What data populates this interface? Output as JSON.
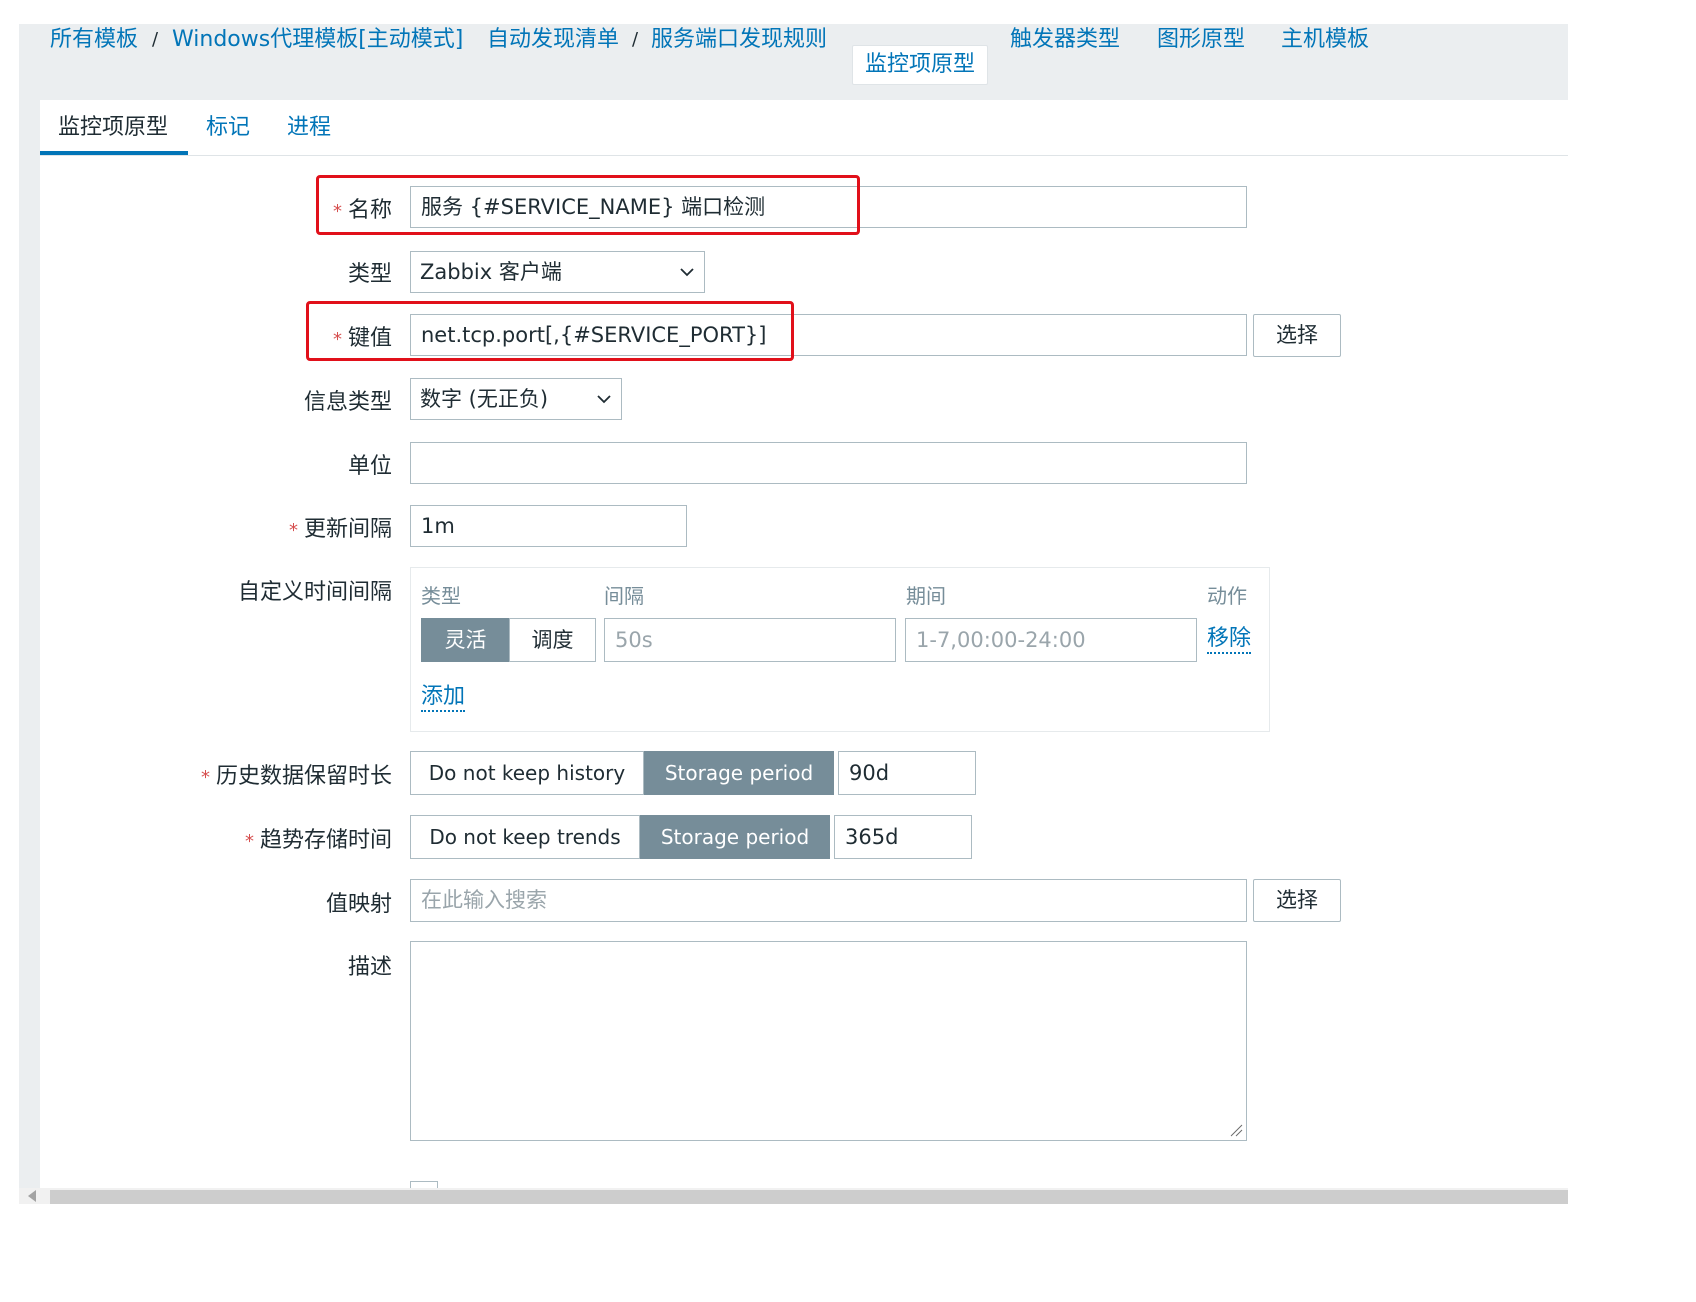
{
  "breadcrumb": {
    "all_templates": "所有模板",
    "template": "Windows代理模板[主动模式]",
    "discovery_list": "自动发现清单",
    "discovery_rule": "服务端口发现规则",
    "sep": "/"
  },
  "nav": {
    "item_prototypes": "监控项原型",
    "trigger_types": "触发器类型",
    "graph_prototypes": "图形原型",
    "host_templates": "主机模板"
  },
  "tabs": [
    "监控项原型",
    "标记",
    "进程"
  ],
  "form": {
    "required_mark": "*",
    "name_label": "名称",
    "name_value": "服务 {#SERVICE_NAME} 端口检测",
    "type_label": "类型",
    "type_value": "Zabbix 客户端",
    "key_label": "键值",
    "key_value": "net.tcp.port[,{#SERVICE_PORT}]",
    "select_button": "选择",
    "info_type_label": "信息类型",
    "info_type_value": "数字 (无正负)",
    "units_label": "单位",
    "units_value": "",
    "update_interval_label": "更新间隔",
    "update_interval_value": "1m",
    "custom_intervals_label": "自定义时间间隔",
    "custom_intervals": {
      "col_type": "类型",
      "col_interval": "间隔",
      "col_period": "期间",
      "col_action": "动作",
      "flexible": "灵活",
      "scheduling": "调度",
      "interval_placeholder": "50s",
      "period_placeholder": "1-7,00:00-24:00",
      "remove": "移除",
      "add": "添加"
    },
    "history_label": "历史数据保留时长",
    "history_off": "Do not keep history",
    "history_on": "Storage period",
    "history_value": "90d",
    "trends_label": "趋势存储时间",
    "trends_off": "Do not keep trends",
    "trends_on": "Storage period",
    "trends_value": "365d",
    "valuemap_label": "值映射",
    "valuemap_placeholder": "在此输入搜索",
    "description_label": "描述",
    "description_value": ""
  },
  "colors": {
    "link": "#0275b8",
    "required": "#d64e4e",
    "highlight": "#e1101a",
    "toggle_on": "#768d99"
  }
}
